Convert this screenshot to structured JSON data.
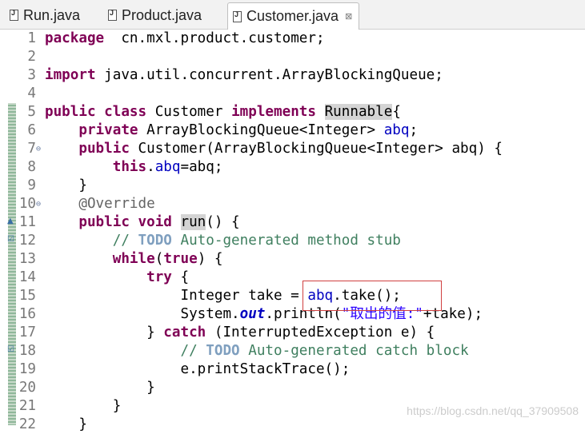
{
  "tabs": [
    {
      "label": "Run.java",
      "icon": "java-file-icon"
    },
    {
      "label": "Product.java",
      "icon": "java-file-icon"
    },
    {
      "label": "Customer.java",
      "icon": "java-file-icon",
      "close": "⊠"
    }
  ],
  "lines": [
    {
      "n": "1",
      "segs": [
        [
          "kw",
          "package"
        ],
        [
          "",
          "  cn.mxl.product.customer;"
        ]
      ]
    },
    {
      "n": "2",
      "segs": []
    },
    {
      "n": "3",
      "segs": [
        [
          "kw",
          "import"
        ],
        [
          "",
          " java.util.concurrent.ArrayBlockingQueue;"
        ]
      ]
    },
    {
      "n": "4",
      "segs": []
    },
    {
      "n": "5",
      "segs": [
        [
          "kw",
          "public"
        ],
        [
          "",
          " "
        ],
        [
          "kw",
          "class"
        ],
        [
          "",
          " Customer "
        ],
        [
          "kw",
          "implements"
        ],
        [
          "",
          " "
        ],
        [
          "hl",
          "Runnable"
        ],
        [
          "",
          "{"
        ]
      ]
    },
    {
      "n": "6",
      "segs": [
        [
          "",
          "    "
        ],
        [
          "kw",
          "private"
        ],
        [
          "",
          " ArrayBlockingQueue<Integer> "
        ],
        [
          "fd",
          "abq"
        ],
        [
          "",
          ";"
        ]
      ]
    },
    {
      "n": "7",
      "fold": "⊖",
      "segs": [
        [
          "",
          "    "
        ],
        [
          "kw",
          "public"
        ],
        [
          "",
          " Customer(ArrayBlockingQueue<Integer> abq) {"
        ]
      ]
    },
    {
      "n": "8",
      "segs": [
        [
          "",
          "        "
        ],
        [
          "kw",
          "this"
        ],
        [
          "",
          "."
        ],
        [
          "fd",
          "abq"
        ],
        [
          "",
          "=abq;"
        ]
      ]
    },
    {
      "n": "9",
      "segs": [
        [
          "",
          "    }"
        ]
      ]
    },
    {
      "n": "10",
      "fold": "⊖",
      "segs": [
        [
          "",
          "    "
        ],
        [
          "an",
          "@Override"
        ]
      ]
    },
    {
      "n": "11",
      "segs": [
        [
          "",
          "    "
        ],
        [
          "kw",
          "public"
        ],
        [
          "",
          " "
        ],
        [
          "kw",
          "void"
        ],
        [
          "",
          " "
        ],
        [
          "hl",
          "run"
        ],
        [
          "",
          "() {"
        ]
      ]
    },
    {
      "n": "12",
      "segs": [
        [
          "",
          "        "
        ],
        [
          "cm",
          "// "
        ],
        [
          "todo",
          "TODO"
        ],
        [
          "cm",
          " Auto-generated method stub"
        ]
      ]
    },
    {
      "n": "13",
      "segs": [
        [
          "",
          "        "
        ],
        [
          "kw",
          "while"
        ],
        [
          "",
          "("
        ],
        [
          "kw",
          "true"
        ],
        [
          "",
          ") {"
        ]
      ]
    },
    {
      "n": "14",
      "segs": [
        [
          "",
          "            "
        ],
        [
          "kw",
          "try"
        ],
        [
          "",
          " {"
        ]
      ]
    },
    {
      "n": "15",
      "segs": [
        [
          "",
          "                Integer take = "
        ],
        [
          "fd",
          "abq"
        ],
        [
          "",
          ".take();"
        ]
      ]
    },
    {
      "n": "16",
      "segs": [
        [
          "",
          "                System."
        ],
        [
          "it",
          "out"
        ],
        [
          "",
          ".println("
        ],
        [
          "st",
          "\"取出的值:\""
        ],
        [
          "",
          "+take);"
        ]
      ]
    },
    {
      "n": "17",
      "segs": [
        [
          "",
          "            } "
        ],
        [
          "kw",
          "catch"
        ],
        [
          "",
          " (InterruptedException e) {"
        ]
      ]
    },
    {
      "n": "18",
      "segs": [
        [
          "",
          "                "
        ],
        [
          "cm",
          "// "
        ],
        [
          "todo",
          "TODO"
        ],
        [
          "cm",
          " Auto-generated catch block"
        ]
      ]
    },
    {
      "n": "19",
      "segs": [
        [
          "",
          "                e.printStackTrace();"
        ]
      ]
    },
    {
      "n": "20",
      "segs": [
        [
          "",
          "            }"
        ]
      ]
    },
    {
      "n": "21",
      "segs": [
        [
          "",
          "        }"
        ]
      ]
    },
    {
      "n": "22",
      "segs": [
        [
          "",
          "    }"
        ]
      ]
    }
  ],
  "watermark": "https://blog.csdn.net/qq_37909508"
}
